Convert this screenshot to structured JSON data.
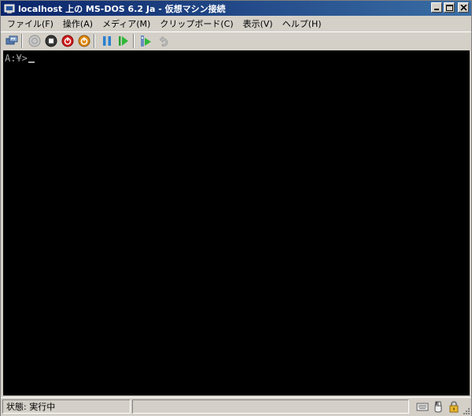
{
  "window": {
    "title": "localhost 上の MS-DOS 6.2 Ja  - 仮想マシン接続",
    "controls": {
      "minimize": "minimize",
      "maximize": "maximize",
      "close": "close"
    }
  },
  "menu": {
    "items": [
      {
        "label": "ファイル(F)"
      },
      {
        "label": "操作(A)"
      },
      {
        "label": "メディア(M)"
      },
      {
        "label": "クリップボード(C)"
      },
      {
        "label": "表示(V)"
      },
      {
        "label": "ヘルプ(H)"
      }
    ]
  },
  "toolbar": {
    "icons": [
      "ctrl-alt-del-icon",
      "start-icon",
      "turn-off-icon",
      "shutdown-icon",
      "save-icon",
      "pause-icon",
      "reset-icon",
      "snapshot-icon",
      "revert-icon"
    ]
  },
  "console": {
    "prompt": "A:¥>"
  },
  "status": {
    "text": "状態: 実行中"
  },
  "colors": {
    "title_start": "#0a246a",
    "title_end": "#3a6ea5",
    "chrome": "#d4d0c8",
    "console_bg": "#000000",
    "console_fg": "#a8a8a8"
  }
}
